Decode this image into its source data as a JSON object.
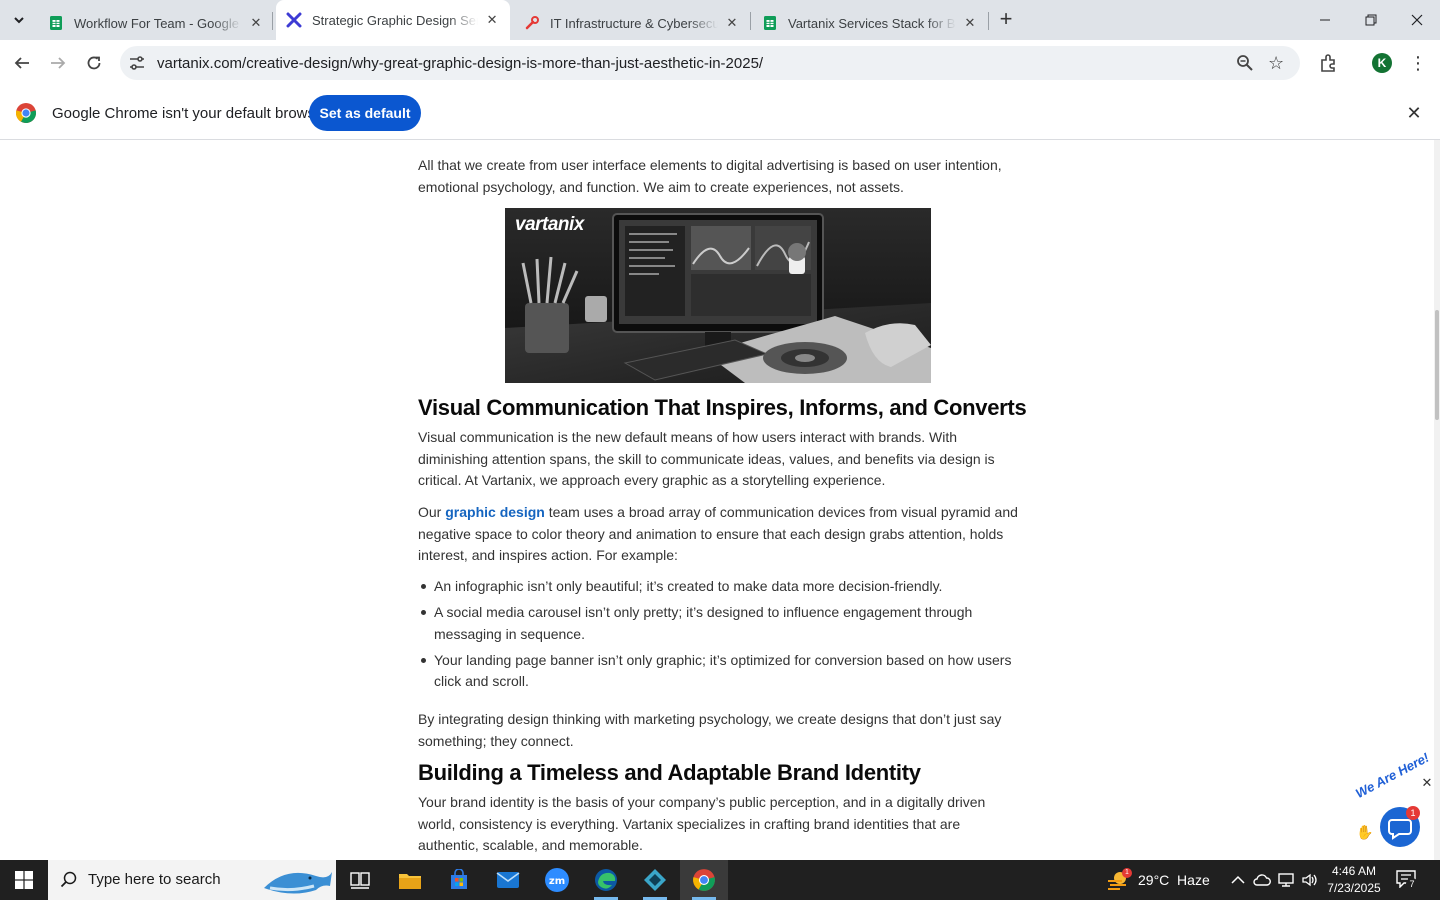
{
  "browser": {
    "tabs": [
      {
        "title": "Workflow For Team - Google Sheets",
        "favicon": "sheets-icon",
        "active": false
      },
      {
        "title": "Strategic Graphic Design Services",
        "favicon": "vartanix-icon",
        "active": true
      },
      {
        "title": "IT Infrastructure & Cybersecurity",
        "favicon": "tool-icon",
        "active": false
      },
      {
        "title": "Vartanix Services Stack for Blog",
        "favicon": "sheets-icon",
        "active": false
      }
    ],
    "url": "vartanix.com/creative-design/why-great-graphic-design-is-more-than-just-aesthetic-in-2025/",
    "profile_initial": "K"
  },
  "infobar": {
    "message": "Google Chrome isn't your default browser",
    "button": "Set as default"
  },
  "article": {
    "intro": "All that we create from user interface elements to digital advertising is based on user intention, emotional psychology, and function. We aim to create experiences, not assets.",
    "hero_logo": "vartanix",
    "section1": {
      "heading": "Visual Communication That Inspires, Informs, and Converts",
      "p1": "Visual communication is the new default means of how users interact with brands. With diminishing attention spans, the skill to communicate ideas, values, and benefits via design is critical. At Vartanix, we approach every graphic as a storytelling experience.",
      "p2_before": "Our ",
      "p2_link": "graphic design",
      "p2_after": " team uses a broad array of communication devices from visual pyramid and negative space to color theory and animation to ensure that each design grabs attention, holds interest, and inspires action. For example:",
      "bullets": [
        "An infographic isn’t only beautiful; it’s created to make data more decision-friendly.",
        "A social media carousel isn’t only pretty; it’s designed to influence engagement through messaging in sequence.",
        "Your landing page banner isn’t only graphic; it’s optimized for conversion based on how users click and scroll."
      ],
      "p3": "By integrating design thinking with marketing psychology, we create designs that don’t just say something; they connect."
    },
    "section2": {
      "heading": "Building a Timeless and Adaptable Brand Identity",
      "p1": "Your brand identity is the basis of your company’s public perception, and in a digitally driven world, consistency is everything. Vartanix specializes in crafting brand identities that are authentic, scalable, and memorable."
    }
  },
  "chat_widget": {
    "label": "We Are Here!",
    "badge": "1"
  },
  "taskbar": {
    "search_placeholder": "Type here to search",
    "weather_badge": "1",
    "weather": "29°C  Haze",
    "time": "4:46 AM",
    "date": "7/23/2025",
    "notification_count": "7"
  }
}
